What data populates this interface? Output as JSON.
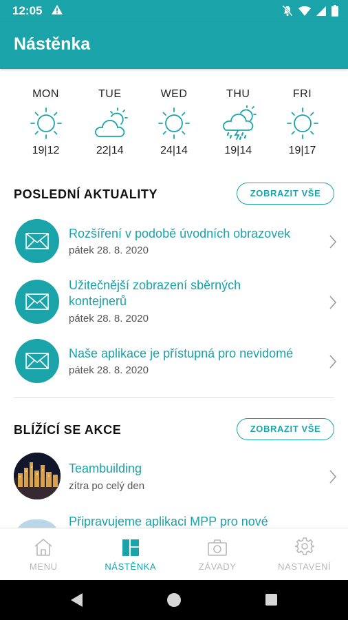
{
  "status_bar": {
    "time": "12:05"
  },
  "app_bar": {
    "title": "Nástěnka"
  },
  "weather": [
    {
      "day": "MON",
      "temp": "19|12",
      "icon": "sun-icon"
    },
    {
      "day": "TUE",
      "temp": "22|14",
      "icon": "partly-cloudy-icon"
    },
    {
      "day": "WED",
      "temp": "24|14",
      "icon": "sun-icon"
    },
    {
      "day": "THU",
      "temp": "19|14",
      "icon": "storm-rain-icon"
    },
    {
      "day": "FRI",
      "temp": "19|17",
      "icon": "sun-icon"
    }
  ],
  "news": {
    "title": "POSLEDNÍ AKTUALITY",
    "show_all": "ZOBRAZIT VŠE",
    "items": [
      {
        "title_lines": [
          "Rozšíření v podobě úvodních obrazovek"
        ],
        "date": "pátek 28. 8. 2020"
      },
      {
        "title_lines": [
          "Užitečnější zobrazení sběrných",
          "kontejnerů"
        ],
        "date": "pátek 28. 8. 2020"
      },
      {
        "title_lines": [
          "Naše aplikace je přístupná pro nevidomé"
        ],
        "date": "pátek 28. 8. 2020"
      }
    ]
  },
  "events": {
    "title": "BLÍŽÍCÍ SE AKCE",
    "show_all": "ZOBRAZIT VŠE",
    "items": [
      {
        "title": "Teambuilding",
        "subtitle": "zítra po celý den"
      },
      {
        "title": "Připravujeme aplikaci MPP pro nové",
        "subtitle": ""
      }
    ]
  },
  "bottom_nav": [
    {
      "label": "MENU",
      "icon": "home-icon",
      "active": false
    },
    {
      "label": "NÁSTĚNKA",
      "icon": "dashboard-icon",
      "active": true
    },
    {
      "label": "ZÁVADY",
      "icon": "camera-icon",
      "active": false
    },
    {
      "label": "NASTAVENÍ",
      "icon": "gear-icon",
      "active": false
    }
  ],
  "colors": {
    "accent": "#1aa3a8",
    "inactive": "#b8b8b8",
    "system_bar": "#000000"
  }
}
